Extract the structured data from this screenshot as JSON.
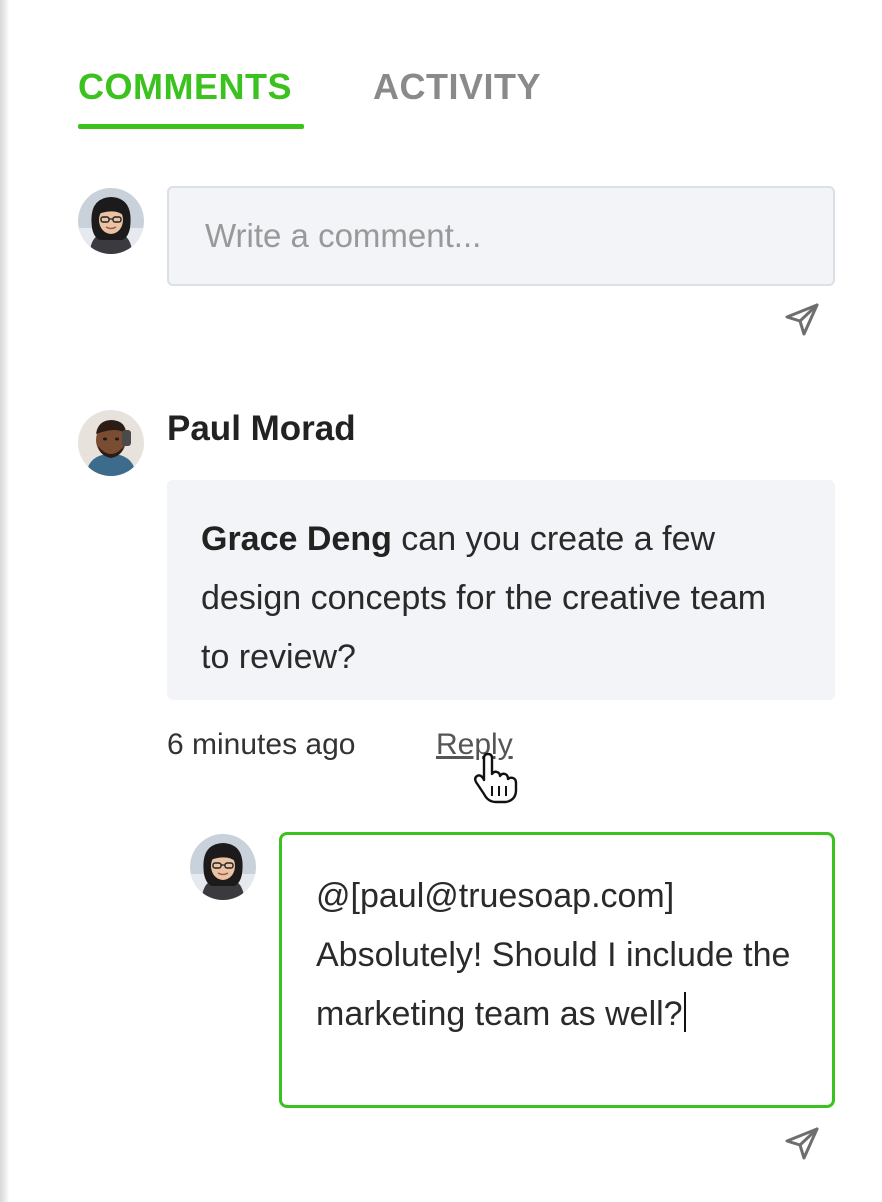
{
  "theme": {
    "accent": "#3cc21f"
  },
  "tabs": {
    "comments": "COMMENTS",
    "activity": "ACTIVITY",
    "active": "comments"
  },
  "composer": {
    "placeholder": "Write a comment...",
    "value": "",
    "avatar_icon": "user-avatar-icon",
    "send_icon": "send-paper-plane-icon"
  },
  "comment": {
    "author": "Paul Morad",
    "mention": "Grace Deng",
    "body": " can you create a few design concepts for the creative team to review?",
    "time": "6 minutes ago",
    "reply_label": "Reply"
  },
  "reply": {
    "text": "@[paul@truesoap.com] Absolutely! Should I include the marketing team as well?",
    "send_icon": "send-paper-plane-icon"
  }
}
